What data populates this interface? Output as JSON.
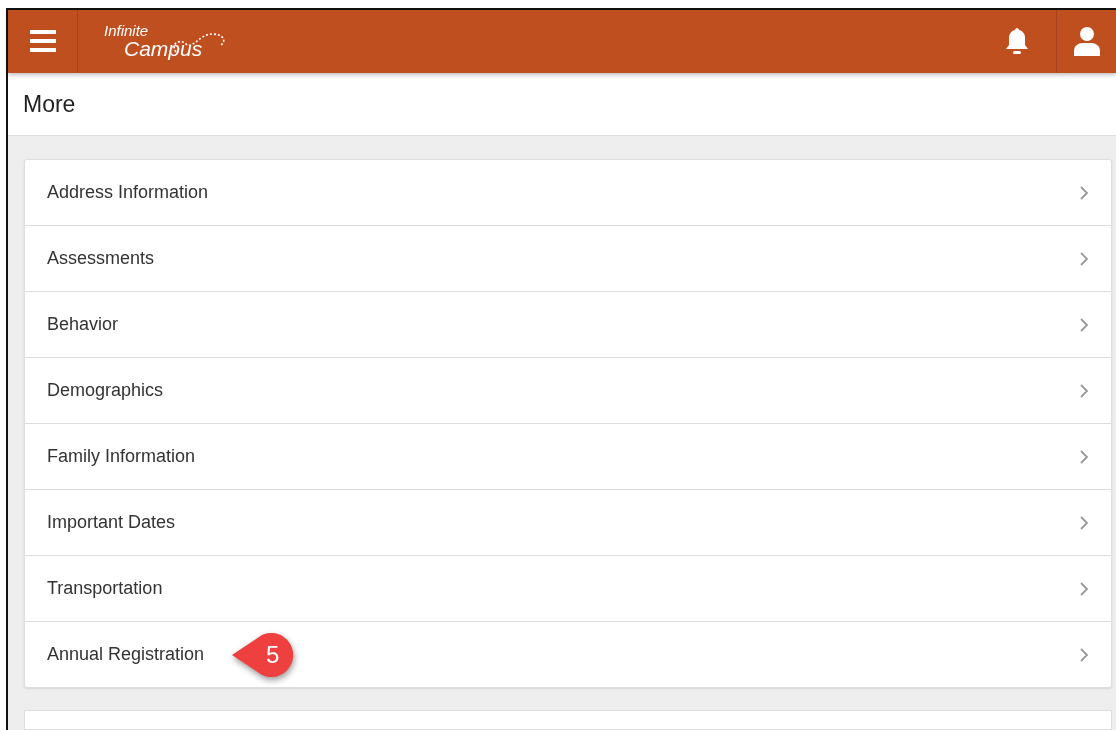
{
  "header": {
    "logo": {
      "line_1": "Infinite",
      "line_2": "Campus"
    }
  },
  "page": {
    "title": "More"
  },
  "menu": [
    {
      "label": "Address Information"
    },
    {
      "label": "Assessments"
    },
    {
      "label": "Behavior"
    },
    {
      "label": "Demographics"
    },
    {
      "label": "Family Information"
    },
    {
      "label": "Important Dates"
    },
    {
      "label": "Transportation"
    },
    {
      "label": "Annual Registration",
      "callout": "5"
    }
  ]
}
